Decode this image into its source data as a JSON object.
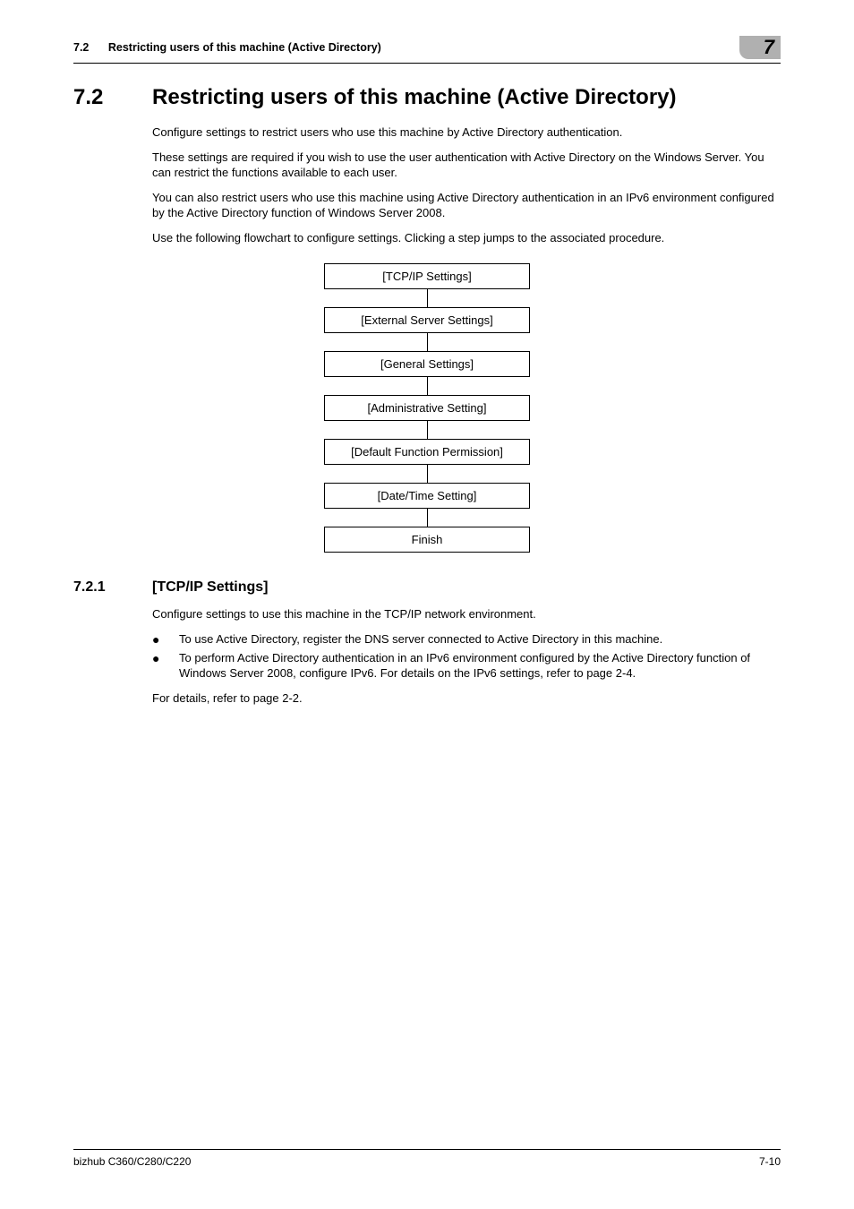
{
  "header": {
    "section_number": "7.2",
    "section_title": "Restricting users of this machine (Active Directory)",
    "chapter_number": "7"
  },
  "h1": {
    "number": "7.2",
    "title": "Restricting users of this machine (Active Directory)"
  },
  "intro": {
    "p1": "Configure settings to restrict users who use this machine by Active Directory authentication.",
    "p2": "These settings are required if you wish to use the user authentication with Active Directory on the Windows Server. You can restrict the functions available to each user.",
    "p3": "You can also restrict users who use this machine using Active Directory authentication in an IPv6 environment configured by the Active Directory function of Windows Server 2008.",
    "p4": "Use the following flowchart to configure settings. Clicking a step jumps to the associated procedure."
  },
  "flowchart": {
    "steps": [
      "[TCP/IP Settings]",
      "[External Server Settings]",
      "[General Settings]",
      "[Administrative Setting]",
      "[Default Function Permission]",
      "[Date/Time Setting]",
      "Finish"
    ]
  },
  "h2": {
    "number": "7.2.1",
    "title": "[TCP/IP Settings]"
  },
  "subsection": {
    "p1": "Configure settings to use this machine in the TCP/IP network environment.",
    "bullets": [
      "To use Active Directory, register the DNS server connected to Active Directory in this machine.",
      "To perform Active Directory authentication in an IPv6 environment configured by the Active Directory function of Windows Server 2008, configure IPv6. For details on the IPv6 settings, refer to page 2-4."
    ],
    "p2": "For details, refer to page 2-2."
  },
  "footer": {
    "model": "bizhub C360/C280/C220",
    "page": "7-10"
  }
}
